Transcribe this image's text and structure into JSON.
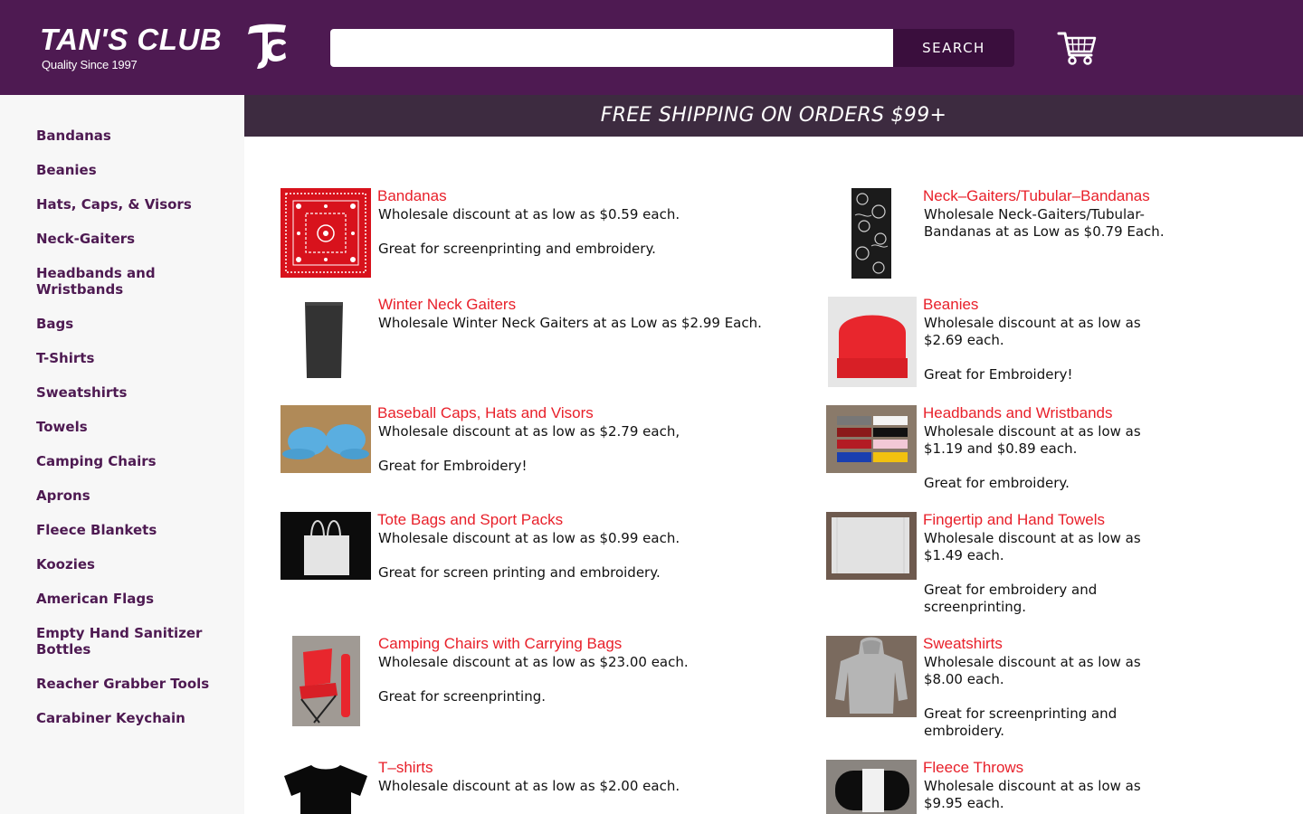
{
  "header": {
    "logo_title": "TAN'S CLUB",
    "logo_subtitle": "Quality Since 1997",
    "search_placeholder": "",
    "search_value": "",
    "search_button": "SEARCH",
    "cart_icon": "shopping-cart-icon",
    "bg_color": "#4e1a52"
  },
  "banner": {
    "text": "FREE SHIPPING ON ORDERS $99+"
  },
  "sidebar": {
    "items": [
      {
        "label": "Bandanas"
      },
      {
        "label": "Beanies"
      },
      {
        "label": "Hats, Caps, & Visors"
      },
      {
        "label": "Neck-Gaiters"
      },
      {
        "label": "Headbands and Wristbands"
      },
      {
        "label": "Bags"
      },
      {
        "label": "T-Shirts"
      },
      {
        "label": "Sweatshirts"
      },
      {
        "label": "Towels"
      },
      {
        "label": "Camping Chairs"
      },
      {
        "label": "Aprons"
      },
      {
        "label": "Fleece Blankets"
      },
      {
        "label": "Koozies"
      },
      {
        "label": "American Flags"
      },
      {
        "label": "Empty Hand Sanitizer Bottles"
      },
      {
        "label": "Reacher Grabber Tools"
      },
      {
        "label": "Carabiner Keychain"
      }
    ]
  },
  "products": {
    "bandanas": {
      "title": "Bandanas",
      "desc": "Wholesale discount at as low as $0.59 each.",
      "note": "Great for screenprinting and embroidery."
    },
    "neck_gaiters_tubular": {
      "title": "Neck–Gaiters/Tubular–Bandanas",
      "desc": "Wholesale Neck-Gaiters/Tubular-Bandanas at as Low as $0.79 Each.",
      "note": ""
    },
    "winter_neck_gaiters": {
      "title": "Winter Neck Gaiters",
      "desc": "Wholesale Winter Neck Gaiters at as Low as $2.99 Each.",
      "note": ""
    },
    "beanies": {
      "title": "Beanies",
      "desc": "Wholesale discount at as low as $2.69 each.",
      "note": "Great for Embroidery!"
    },
    "baseball_caps": {
      "title": "Baseball Caps, Hats and Visors",
      "desc": "Wholesale discount at as low as $2.79 each,",
      "note": "Great for Embroidery!"
    },
    "headbands": {
      "title": "Headbands and Wristbands",
      "desc": "Wholesale discount at as low as $1.19 and $0.89 each.",
      "note": "Great for embroidery."
    },
    "tote_bags": {
      "title": "Tote Bags and Sport Packs",
      "desc": "Wholesale discount at as low as $0.99 each.",
      "note": "Great for screen printing and embroidery."
    },
    "towels": {
      "title": "Fingertip and Hand Towels",
      "desc": "Wholesale discount at as low as $1.49 each.",
      "note": "Great for embroidery and screenprinting."
    },
    "camping_chairs": {
      "title": "Camping Chairs with Carrying Bags",
      "desc": "Wholesale discount at as low as $23.00 each.",
      "note": "Great for screenprinting."
    },
    "sweatshirts": {
      "title": "Sweatshirts",
      "desc": "Wholesale discount at as low as $8.00 each.",
      "note": "Great for screenprinting and embroidery."
    },
    "tshirts": {
      "title": "T–shirts",
      "desc": "Wholesale discount at as low as $2.00 each.",
      "note": ""
    },
    "fleece_throws": {
      "title": "Fleece Throws",
      "desc": "Wholesale discount at as low as $9.95 each.",
      "note": ""
    }
  },
  "colors": {
    "brand_purple": "#4e1a52",
    "banner_bg": "#3d2b40",
    "product_title_red": "#e8202a",
    "sidebar_bg": "#f7f7f7"
  }
}
